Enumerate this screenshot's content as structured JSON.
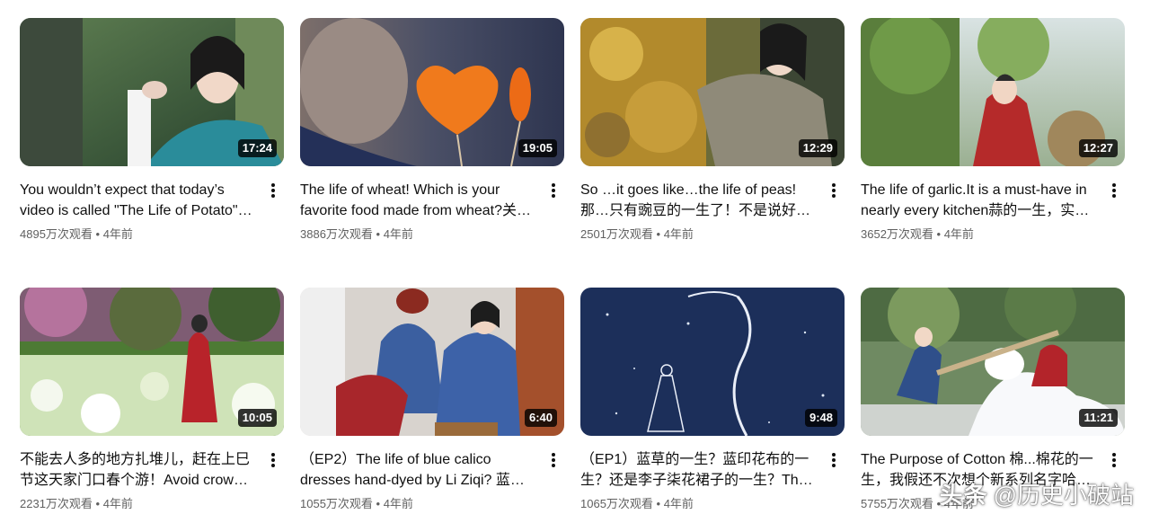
{
  "videos": [
    {
      "title": "You wouldn’t expect that today’s video is called \"The Life of Potato\"…",
      "views": "4895万次观看",
      "age": "4年前",
      "duration": "17:24",
      "thumb_icon": "woman-forest-thumbnail"
    },
    {
      "title": "The life of wheat! Which is your favorite food made from wheat?关…",
      "views": "3886万次观看",
      "age": "4年前",
      "duration": "19:05",
      "thumb_icon": "candy-hearts-thumbnail"
    },
    {
      "title": "So …it goes like…the life of peas! 那…只有豌豆的一生了！不是说好…",
      "views": "2501万次观看",
      "age": "4年前",
      "duration": "12:29",
      "thumb_icon": "pea-harvest-thumbnail"
    },
    {
      "title": "The life of garlic.It is a must-have in nearly every kitchen蒜的一生，实…",
      "views": "3652万次观看",
      "age": "4年前",
      "duration": "12:27",
      "thumb_icon": "garlic-field-thumbnail"
    },
    {
      "title": "不能去人多的地方扎堆儿，赶在上巳节这天家门口春个游！Avoid crow…",
      "views": "2231万次观看",
      "age": "4年前",
      "duration": "10:05",
      "thumb_icon": "flower-field-thumbnail"
    },
    {
      "title": "（EP2）The life of blue calico dresses hand-dyed by Li Ziqi? 蓝…",
      "views": "1055万次观看",
      "age": "4年前",
      "duration": "6:40",
      "thumb_icon": "blue-calico-thumbnail"
    },
    {
      "title": "（EP1）蓝草的一生？蓝印花布的一生？还是李子柒花裙子的一生？Th…",
      "views": "1065万次观看",
      "age": "4年前",
      "duration": "9:48",
      "thumb_icon": "indigo-illustration-thumbnail"
    },
    {
      "title": "The Purpose of Cotton 棉...棉花的一生，我假还不次想个新系列名字哈…",
      "views": "5755万次观看",
      "age": "4年前",
      "duration": "11:21",
      "thumb_icon": "cotton-yard-thumbnail"
    }
  ],
  "separator": " • ",
  "watermark": {
    "logo": "头条",
    "text": "@历史小破站"
  }
}
